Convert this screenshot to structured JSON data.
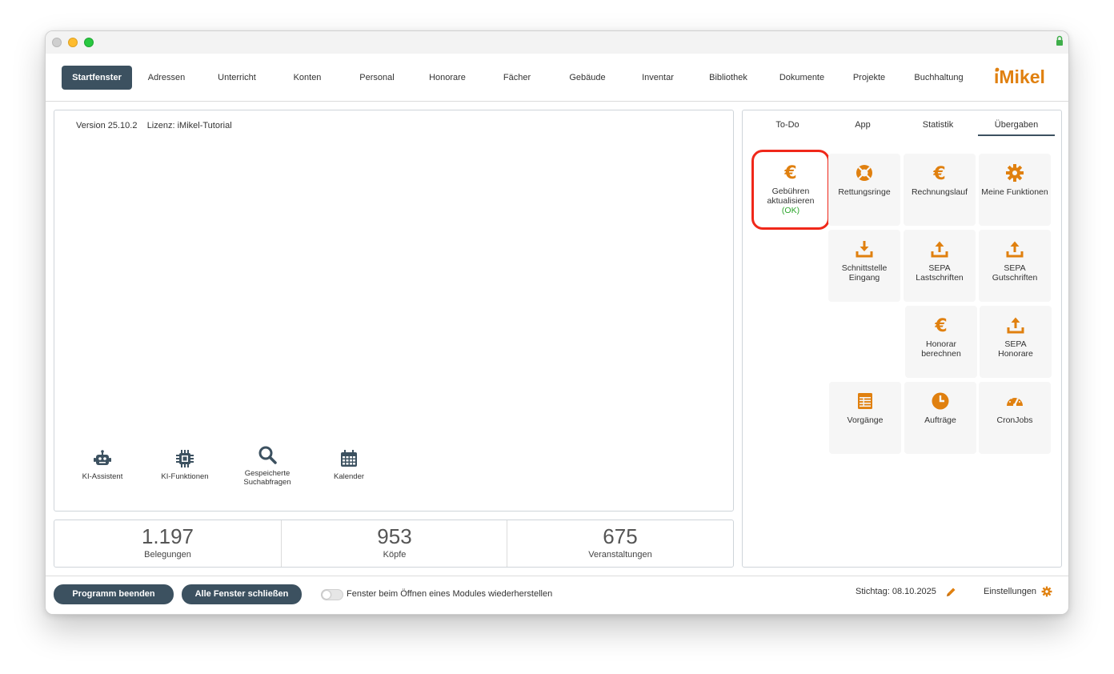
{
  "colors": {
    "accent": "#3c5160",
    "icon_orange": "#e0800f",
    "ok_green": "#2aa52a",
    "highlight_red": "#f0281a"
  },
  "nav": {
    "items": [
      {
        "label": "Startfenster"
      },
      {
        "label": "Adressen"
      },
      {
        "label": "Unterricht"
      },
      {
        "label": "Konten"
      },
      {
        "label": "Personal"
      },
      {
        "label": "Honorare"
      },
      {
        "label": "Fächer"
      },
      {
        "label": "Gebäude"
      },
      {
        "label": "Inventar"
      },
      {
        "label": "Bibliothek"
      },
      {
        "label": "Dokumente"
      },
      {
        "label": "Projekte"
      },
      {
        "label": "Buchhaltung"
      }
    ],
    "logo_text": "iMikel"
  },
  "main": {
    "version": "Version 25.10.2",
    "license": "Lizenz: iMikel-Tutorial",
    "tools": [
      {
        "label": "KI-Assistent",
        "icon": "robot-icon"
      },
      {
        "label": "KI-Funktionen",
        "icon": "chip-icon"
      },
      {
        "label_line1": "Gespeicherte",
        "label_line2": "Suchabfragen",
        "icon": "search-icon"
      },
      {
        "label": "Kalender",
        "icon": "calendar-icon"
      }
    ]
  },
  "stats": [
    {
      "value": "1.197",
      "label": "Belegungen"
    },
    {
      "value": "953",
      "label": "Köpfe"
    },
    {
      "value": "675",
      "label": "Veranstaltungen"
    }
  ],
  "right": {
    "tabs": [
      {
        "label": "To-Do"
      },
      {
        "label": "App"
      },
      {
        "label": "Statistik"
      },
      {
        "label": "Übergaben"
      }
    ],
    "active_tab": "Übergaben",
    "tiles": [
      {
        "line1": "Gebühren",
        "line2": "aktualisieren",
        "status": "(OK)",
        "icon": "euro-icon"
      },
      {
        "line1": "Rettungsringe",
        "icon": "lifebuoy-icon"
      },
      {
        "line1": "Rechnungslauf",
        "icon": "euro-icon"
      },
      {
        "line1": "Meine Funktionen",
        "icon": "gear-icon"
      },
      {
        "line1": "Schnittstelle",
        "line2": "Eingang",
        "icon": "download-icon"
      },
      {
        "line1": "SEPA",
        "line2": "Lastschriften",
        "icon": "upload-icon"
      },
      {
        "line1": "SEPA",
        "line2": "Gutschriften",
        "icon": "upload-icon"
      },
      {
        "line1": "Honorar",
        "line2": "berechnen",
        "icon": "euro-icon"
      },
      {
        "line1": "SEPA",
        "line2": "Honorare",
        "icon": "upload-icon"
      },
      {
        "line1": "Vorgänge",
        "icon": "table-icon"
      },
      {
        "line1": "Aufträge",
        "icon": "clock-icon"
      },
      {
        "line1": "CronJobs",
        "icon": "gauge-icon"
      }
    ]
  },
  "footer": {
    "quit_label": "Programm beenden",
    "close_all_label": "Alle Fenster schließen",
    "toggle_label": "Fenster beim Öffnen eines Modules wiederherstellen",
    "stichtag": "Stichtag: 08.10.2025",
    "settings_label": "Einstellungen"
  }
}
